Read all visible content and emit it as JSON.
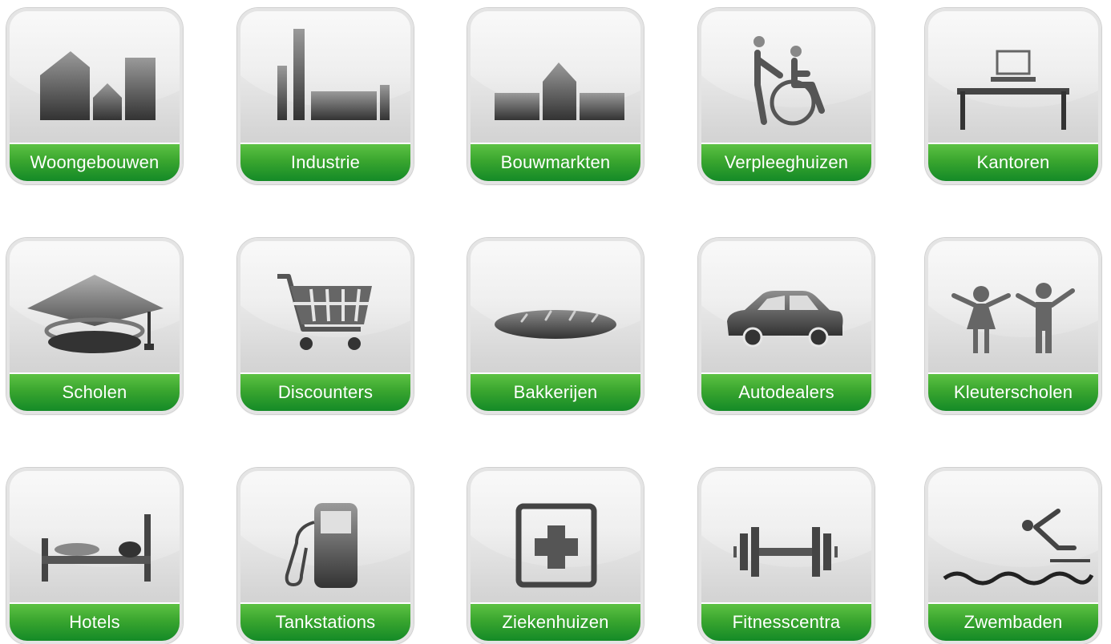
{
  "colors": {
    "label_green": "#2e9f2d",
    "icon_dark": "#333333",
    "tile_bg": "#e6e6e6"
  },
  "tiles": [
    {
      "label": "Woongebouwen",
      "icon": "apartment-buildings-icon"
    },
    {
      "label": "Industrie",
      "icon": "factory-icon"
    },
    {
      "label": "Bouwmarkten",
      "icon": "hardware-store-icon"
    },
    {
      "label": "Verpleeghuizen",
      "icon": "wheelchair-care-icon"
    },
    {
      "label": "Kantoren",
      "icon": "office-desk-icon"
    },
    {
      "label": "Scholen",
      "icon": "graduation-cap-icon"
    },
    {
      "label": "Discounters",
      "icon": "shopping-cart-icon"
    },
    {
      "label": "Bakkerijen",
      "icon": "bread-icon"
    },
    {
      "label": "Autodealers",
      "icon": "car-icon"
    },
    {
      "label": "Kleuterscholen",
      "icon": "children-icon"
    },
    {
      "label": "Hotels",
      "icon": "bed-icon"
    },
    {
      "label": "Tankstations",
      "icon": "fuel-pump-icon"
    },
    {
      "label": "Ziekenhuizen",
      "icon": "hospital-cross-icon"
    },
    {
      "label": "Fitnesscentra",
      "icon": "dumbbell-icon"
    },
    {
      "label": "Zwembaden",
      "icon": "swimmer-icon"
    }
  ]
}
